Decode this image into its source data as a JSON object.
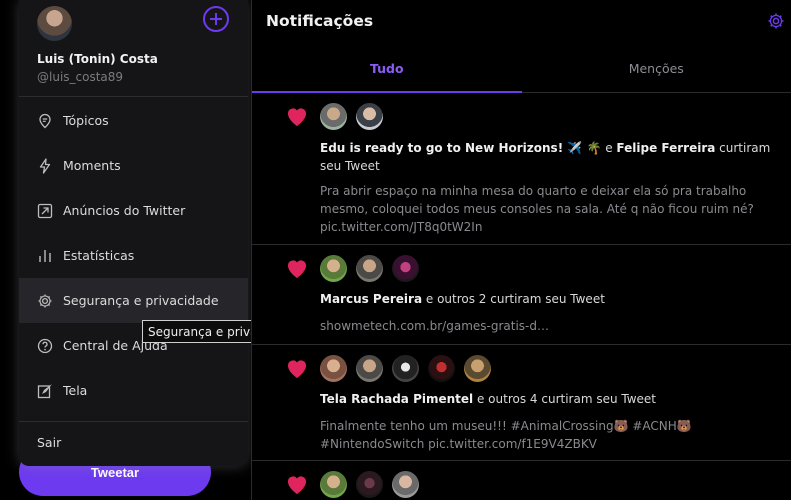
{
  "menu": {
    "user_name": "Luis (Tonin) Costa",
    "user_handle": "@luis_costa89",
    "items": [
      {
        "label": "Tópicos",
        "icon": "topics-icon"
      },
      {
        "label": "Moments",
        "icon": "lightning-icon"
      },
      {
        "label": "Anúncios do Twitter",
        "icon": "external-link-icon"
      },
      {
        "label": "Estatísticas",
        "icon": "bar-chart-icon"
      },
      {
        "label": "Segurança e privacidade",
        "icon": "gear-icon"
      },
      {
        "label": "Central de Ajuda",
        "icon": "help-icon"
      },
      {
        "label": "Tela",
        "icon": "edit-display-icon"
      }
    ],
    "exit_label": "Sair"
  },
  "tooltip": "Segurança e privacidade",
  "tweet_button": "Tweetar",
  "main": {
    "title": "Notificações",
    "tabs": [
      {
        "label": "Tudo",
        "active": true
      },
      {
        "label": "Menções",
        "active": false
      }
    ],
    "notifications": [
      {
        "actor1": "Edu is ready to go to New Horizons! ✈️ 🌴",
        "connector": " e ",
        "actor2": "Felipe Ferreira",
        "action": " curtiram seu Tweet",
        "snippet": "Pra abrir espaço na minha mesa do quarto e deixar ela só pra trabalho mesmo, coloquei todos meus consoles na sala. Até q não ficou ruim né? pic.twitter.com/JT8q0tW2In"
      },
      {
        "actor1": "Marcus Pereira",
        "action": " e outros 2 curtiram seu Tweet",
        "snippet": "showmetech.com.br/games-gratis-d…"
      },
      {
        "actor1": "Tela Rachada Pimentel",
        "action": " e outros 4 curtiram seu Tweet",
        "snippet": "Finalmente tenho um museu!!! #AnimalCrossing🐻 #ACNH🐻 #NintendoSwitch pic.twitter.com/f1E9V4ZBKV"
      }
    ]
  },
  "colors": {
    "accent": "#6d3af0",
    "heart": "#e0245e",
    "menu_bg": "#151518"
  }
}
